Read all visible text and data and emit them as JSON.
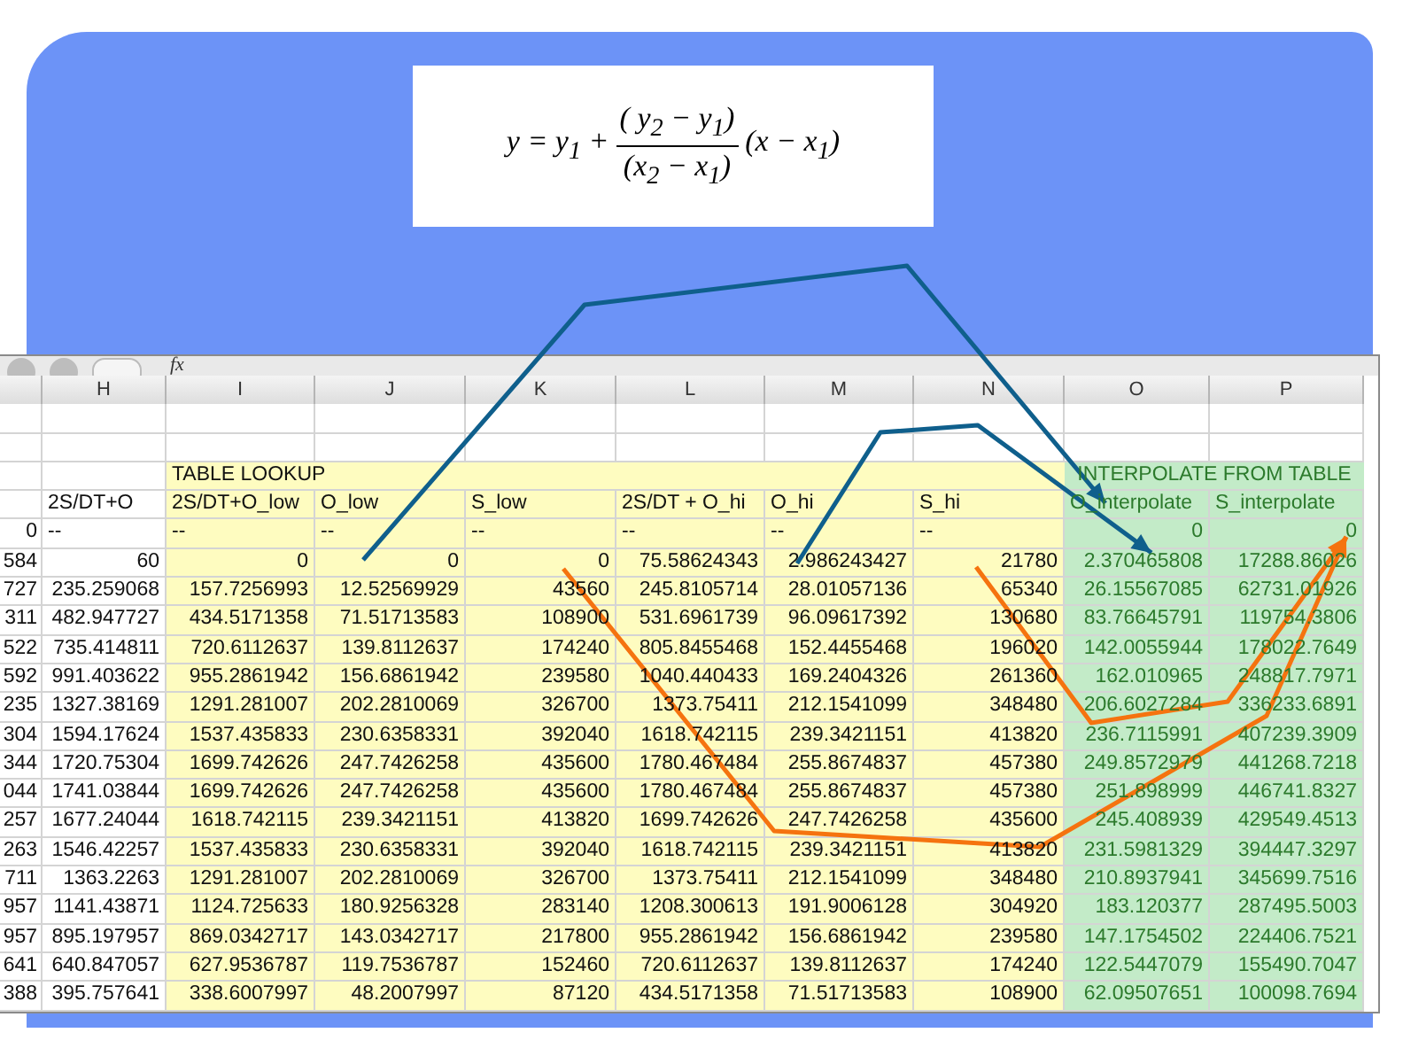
{
  "formula": {
    "lhs": "y = y$_{1}$ +",
    "numerator": "( y$_{2}$ − y$_{1}$)",
    "denominator": "(x$_{2}$ − x$_{1}$)",
    "rhs": "(x − x$_{1}$)"
  },
  "spreadsheet": {
    "toolbar": {
      "function_label": "fx"
    },
    "columns": [
      "",
      "H",
      "I",
      "J",
      "K",
      "L",
      "M",
      "N",
      "O",
      "P"
    ],
    "sections": [
      {
        "kind": "lookup",
        "text": "TABLE LOOKUP"
      },
      {
        "kind": "interpolate",
        "text": "INTERPOLATE FROM TABLE"
      }
    ],
    "header_row": [
      "2S/DT+O",
      "2S/DT+O_low",
      "O_low",
      "S_low",
      "2S/DT + O_hi",
      "O_hi",
      "S_hi",
      "O_interpolate",
      "S_interpolate"
    ],
    "rows": [
      [
        "0",
        "--",
        "--",
        "--",
        "--",
        "--",
        "--",
        "--",
        "0",
        "0"
      ],
      [
        "584",
        "60",
        "0",
        "0",
        "0",
        "75.58624343",
        "2.986243427",
        "21780",
        "2.370465808",
        "17288.86026"
      ],
      [
        "727",
        "235.259068",
        "157.7256993",
        "12.52569929",
        "43560",
        "245.8105714",
        "28.01057136",
        "65340",
        "26.15567085",
        "62731.01926"
      ],
      [
        "311",
        "482.947727",
        "434.5171358",
        "71.51713583",
        "108900",
        "531.6961739",
        "96.09617392",
        "130680",
        "83.76645791",
        "119754.3806"
      ],
      [
        "522",
        "735.414811",
        "720.6112637",
        "139.8112637",
        "174240",
        "805.8455468",
        "152.4455468",
        "196020",
        "142.0055944",
        "178022.7649"
      ],
      [
        "592",
        "991.403622",
        "955.2861942",
        "156.6861942",
        "239580",
        "1040.440433",
        "169.2404326",
        "261360",
        "162.010965",
        "248817.7971"
      ],
      [
        "235",
        "1327.38169",
        "1291.281007",
        "202.2810069",
        "326700",
        "1373.75411",
        "212.1541099",
        "348480",
        "206.6027284",
        "336233.6891"
      ],
      [
        "304",
        "1594.17624",
        "1537.435833",
        "230.6358331",
        "392040",
        "1618.742115",
        "239.3421151",
        "413820",
        "236.7115991",
        "407239.3909"
      ],
      [
        "344",
        "1720.75304",
        "1699.742626",
        "247.7426258",
        "435600",
        "1780.467484",
        "255.8674837",
        "457380",
        "249.8572979",
        "441268.7218"
      ],
      [
        "044",
        "1741.03844",
        "1699.742626",
        "247.7426258",
        "435600",
        "1780.467484",
        "255.8674837",
        "457380",
        "251.898999",
        "446741.8327"
      ],
      [
        "257",
        "1677.24044",
        "1618.742115",
        "239.3421151",
        "413820",
        "1699.742626",
        "247.7426258",
        "435600",
        "245.408939",
        "429549.4513"
      ],
      [
        "263",
        "1546.42257",
        "1537.435833",
        "230.6358331",
        "392040",
        "1618.742115",
        "239.3421151",
        "413820",
        "231.5981329",
        "394447.3297"
      ],
      [
        "711",
        "1363.2263",
        "1291.281007",
        "202.2810069",
        "326700",
        "1373.75411",
        "212.1541099",
        "348480",
        "210.8937941",
        "345699.7516"
      ],
      [
        "957",
        "1141.43871",
        "1124.725633",
        "180.9256328",
        "283140",
        "1208.300613",
        "191.9006128",
        "304920",
        "183.120377",
        "287495.5003"
      ],
      [
        "957",
        "895.197957",
        "869.0342717",
        "143.0342717",
        "217800",
        "955.2861942",
        "156.6861942",
        "239580",
        "147.1754502",
        "224406.7521"
      ],
      [
        "641",
        "640.847057",
        "627.9536787",
        "119.7536787",
        "152460",
        "720.6112637",
        "139.8112637",
        "174240",
        "122.5447079",
        "155490.7047"
      ],
      [
        "388",
        "395.757641",
        "338.6007997",
        "48.2007997",
        "87120",
        "434.5171358",
        "71.51713583",
        "108900",
        "62.09507651",
        "100098.7694"
      ]
    ]
  }
}
